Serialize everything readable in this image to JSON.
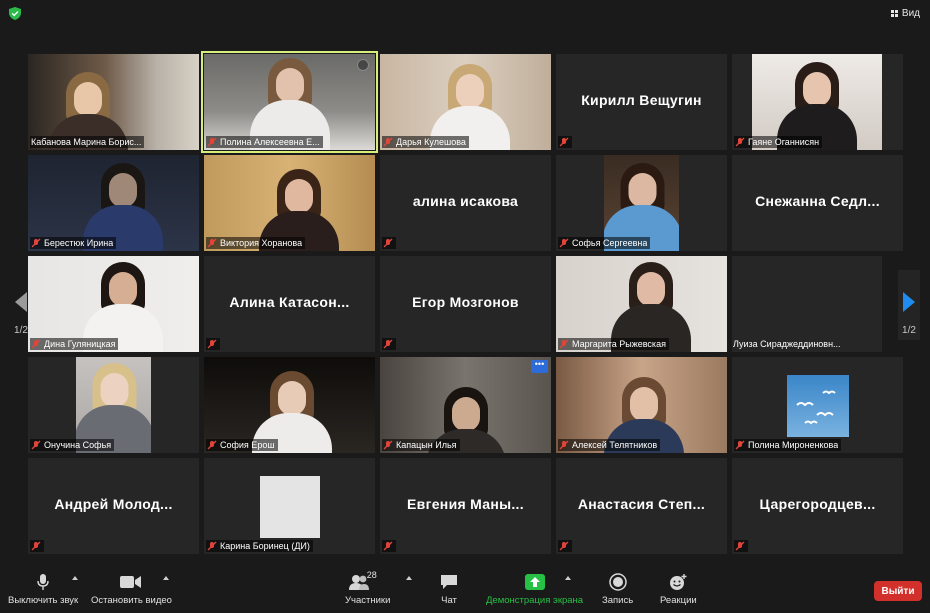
{
  "top": {
    "view_label": "Вид"
  },
  "pagination": {
    "current": "1/2",
    "right": "1/2"
  },
  "participants": [
    {
      "name": "Кабанова Марина Борис...",
      "video": true
    },
    {
      "name": "Полина Алексеевна Е...",
      "video": true,
      "active_speaker": true
    },
    {
      "name": "Дарья Кулешова",
      "video": true
    },
    {
      "name": "Кирилл Вещугин",
      "video": false,
      "name_only": true
    },
    {
      "name": "Гаяне Оганнисян",
      "video": true
    },
    {
      "name": "Берестюк Ирина",
      "video": true
    },
    {
      "name": "Виктория Хоранова",
      "video": true
    },
    {
      "name": "алина исакова",
      "video": false
    },
    {
      "name": "Софья Сергеевна",
      "video": true
    },
    {
      "name": "Снежанна Седл...",
      "video": false
    },
    {
      "name": "Дина Гуляницкая",
      "video": true
    },
    {
      "name": "Алина Катасон...",
      "video": false
    },
    {
      "name": "Егор Мозгонов",
      "video": false
    },
    {
      "name": "Маргарита Рыжевская",
      "video": true
    },
    {
      "name": "Луиза Сираджеддиновн...",
      "video": false
    },
    {
      "name": "Онучина Софья",
      "video": true
    },
    {
      "name": "София Ерош",
      "video": true
    },
    {
      "name": "Капацын Илья",
      "video": true,
      "more_button": "•••"
    },
    {
      "name": "Алексей Телятников",
      "video": true
    },
    {
      "name": "Полина Мироненкова",
      "video": true
    },
    {
      "name": "Андрей Молод...",
      "video": false
    },
    {
      "name": "Карина Боринец (ДИ)",
      "video": true
    },
    {
      "name": "Евгения Маны...",
      "video": false
    },
    {
      "name": "Анастасия Степ...",
      "video": false
    },
    {
      "name": "Царегородцев...",
      "video": false
    }
  ],
  "toolbar": {
    "mute": "Выключить звук",
    "stop_video": "Остановить видео",
    "participants": "Участники",
    "participants_count": "28",
    "chat": "Чат",
    "share": "Демонстрация экрана",
    "record": "Запись",
    "reactions": "Реакции",
    "leave": "Выйти"
  },
  "colors": {
    "accent_green": "#27c046",
    "speaker_outline": "#d7ee7b",
    "leave_red": "#d2312b",
    "nav_blue": "#1e8cf0",
    "muted_red": "#e0453b"
  }
}
